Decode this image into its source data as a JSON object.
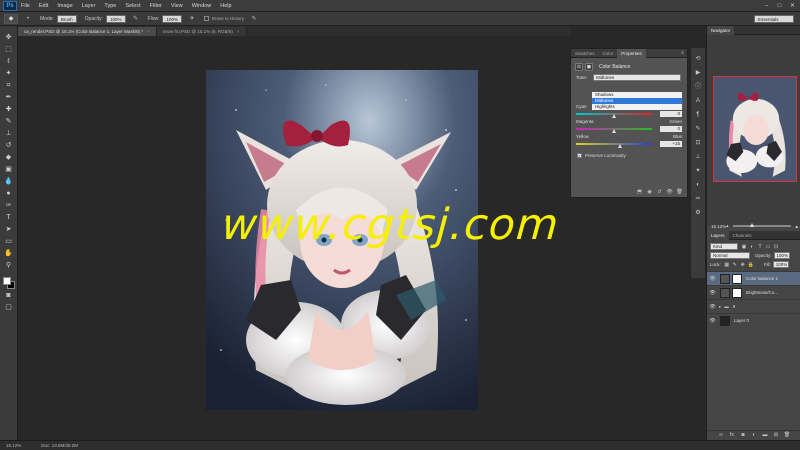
{
  "app": {
    "logo": "Ps",
    "menu": [
      "File",
      "Edit",
      "Image",
      "Layer",
      "Type",
      "Select",
      "Filter",
      "View",
      "Window",
      "Help"
    ]
  },
  "options_bar": {
    "mode_label": "Mode:",
    "mode_value": "Brush",
    "opacity_label": "Opacity:",
    "opacity_value": "100%",
    "flow_label": "Flow:",
    "flow_value": "100%",
    "erase_history": "Erase to History",
    "workspace": "Essentials"
  },
  "tabs": [
    {
      "label": "ca_render.PSD @ 15.1% (Color Balance 1, Layer Mask/8) *",
      "active": true
    },
    {
      "label": "snow fro.PSD @ 15.1% (8, RGB/8)",
      "active": false
    }
  ],
  "properties_panel": {
    "tabs": [
      "Swatches",
      "Color",
      "Properties"
    ],
    "active_tab": "Properties",
    "title": "Color Balance",
    "tone_label": "Tone:",
    "tone_value": "Midtones",
    "tone_options": [
      "Shadows",
      "Midtones",
      "Highlights"
    ],
    "tone_selected": "Midtones",
    "sliders": [
      {
        "left": "Cyan",
        "right": "Red",
        "value": "0",
        "colors": [
          "#00c8d0",
          "#e02020"
        ],
        "pos": 0.5
      },
      {
        "left": "Magenta",
        "right": "Green",
        "value": "0",
        "colors": [
          "#d020c0",
          "#20c020"
        ],
        "pos": 0.5
      },
      {
        "left": "Yellow",
        "right": "Blue",
        "value": "+15",
        "colors": [
          "#e0d020",
          "#2040e0"
        ],
        "pos": 0.575
      }
    ],
    "preserve_luminosity": "Preserve Luminosity"
  },
  "navigator": {
    "tabs": [
      "Navigator"
    ],
    "zoom": "15.12%"
  },
  "layers": {
    "tabs": [
      "Layers",
      "Channels"
    ],
    "kind": "Kind",
    "blend_mode": "Normal",
    "opacity_label": "Opacity:",
    "opacity_value": "100%",
    "lock_label": "Lock:",
    "fill_label": "Fill:",
    "fill_value": "100%",
    "items": [
      {
        "name": "Color Balance 1",
        "selected": true,
        "thumb": "mask"
      },
      {
        "name": "Brightness/Co...",
        "selected": false,
        "thumb": "mask"
      },
      {
        "name": "8",
        "selected": false,
        "thumb": "folder"
      },
      {
        "name": "Layer 0",
        "selected": false,
        "thumb": "dark"
      }
    ]
  },
  "status": {
    "zoom": "15.12%",
    "doc": "Doc: 13.6M/39.2M"
  },
  "watermark": "www.cgtsj.com"
}
